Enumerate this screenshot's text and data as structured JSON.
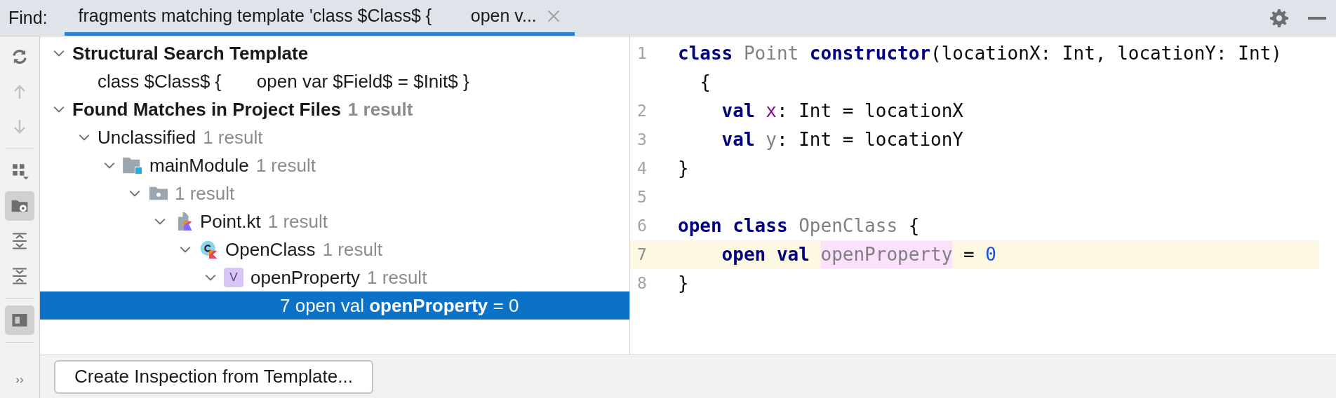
{
  "find_bar": {
    "label": "Find:",
    "tabs": [
      {
        "title": "fragments matching template 'class $Class$ {        open v...",
        "selected": true,
        "closable": true
      }
    ]
  },
  "toolbar": [
    {
      "kind": "refresh",
      "disabled": false,
      "selected": false
    },
    {
      "kind": "up",
      "disabled": true,
      "selected": false
    },
    {
      "kind": "down",
      "disabled": true,
      "selected": false
    },
    {
      "kind": "divider"
    },
    {
      "kind": "group-by",
      "disabled": false,
      "selected": false
    },
    {
      "kind": "module-folder",
      "disabled": false,
      "selected": true
    },
    {
      "kind": "expand-all",
      "disabled": false,
      "selected": false
    },
    {
      "kind": "collapse-all",
      "disabled": false,
      "selected": false
    },
    {
      "kind": "divider"
    },
    {
      "kind": "preview",
      "disabled": false,
      "selected": true
    },
    {
      "kind": "divider"
    }
  ],
  "toolbar_overflow": "››",
  "tree": [
    {
      "kind": "heading",
      "label": "Structural Search Template",
      "expanded": true,
      "selected": false,
      "children": [
        {
          "label": "class $Class$ {       open var $Field$ = $Init$ }",
          "selected": false
        }
      ]
    },
    {
      "kind": "heading",
      "label": "Found Matches in Project Files",
      "count": "1 result",
      "expanded": true,
      "selected": false,
      "children": [
        {
          "label": "Unclassified",
          "count": "1 result",
          "expanded": true,
          "selected": false,
          "children": [
            {
              "kind": "module",
              "label": "mainModule",
              "count": "1 result",
              "expanded": true,
              "selected": false,
              "children": [
                {
                  "kind": "package",
                  "count": "1 result",
                  "expanded": true,
                  "selected": false,
                  "children": [
                    {
                      "kind": "file",
                      "label": "Point.kt",
                      "count": "1 result",
                      "expanded": true,
                      "selected": false,
                      "children": [
                        {
                          "kind": "class",
                          "label": "OpenClass",
                          "count": "1 result",
                          "expanded": true,
                          "selected": false,
                          "children": [
                            {
                              "kind": "property",
                              "icon_letter": "V",
                              "label": "openProperty",
                              "count": "1 result",
                              "expanded": true,
                              "selected": false,
                              "children": [
                                {
                                  "kind": "usage",
                                  "label": "7 open val **openProperty** = 0",
                                  "selected": true
                                }
                              ]
                            }
                          ]
                        }
                      ]
                    }
                  ]
                }
              ]
            }
          ]
        }
      ]
    }
  ],
  "editor": {
    "lines": [
      {
        "number": "1",
        "current": false,
        "tokens": [
          {
            "kind": "keyword",
            "text": "class "
          },
          {
            "kind": "unused",
            "text": "Point "
          },
          {
            "kind": "keyword",
            "text": "constructor"
          },
          {
            "kind": "plain",
            "text": "(locationX: Int, locationY: Int)"
          }
        ],
        "continuation": [
          {
            "kind": "plain",
            "text": "  {"
          }
        ]
      },
      {
        "number": "2",
        "current": false,
        "tokens": [
          {
            "kind": "keyword",
            "text": "    val "
          },
          {
            "kind": "field",
            "text": "x"
          },
          {
            "kind": "plain",
            "text": ": Int = locationX"
          }
        ]
      },
      {
        "number": "3",
        "current": false,
        "tokens": [
          {
            "kind": "keyword",
            "text": "    val "
          },
          {
            "kind": "unused",
            "text": "y"
          },
          {
            "kind": "plain",
            "text": ": Int = locationY"
          }
        ]
      },
      {
        "number": "4",
        "current": false,
        "tokens": [
          {
            "kind": "plain",
            "text": "}"
          }
        ]
      },
      {
        "number": "5",
        "current": false
      },
      {
        "number": "6",
        "current": false,
        "tokens": [
          {
            "kind": "keyword",
            "text": "open class "
          },
          {
            "kind": "unused",
            "text": "OpenClass"
          },
          {
            "kind": "plain",
            "text": " {"
          }
        ]
      },
      {
        "number": "7",
        "current": true,
        "tokens": [
          {
            "kind": "keyword",
            "text": "    open val "
          },
          {
            "kind": "match",
            "text": "openProperty"
          },
          {
            "kind": "plain",
            "text": " = "
          },
          {
            "kind": "number",
            "text": "0"
          }
        ]
      },
      {
        "number": "8",
        "current": false,
        "tokens": [
          {
            "kind": "plain",
            "text": "}"
          }
        ]
      }
    ]
  },
  "create_button": "Create Inspection from Template..."
}
